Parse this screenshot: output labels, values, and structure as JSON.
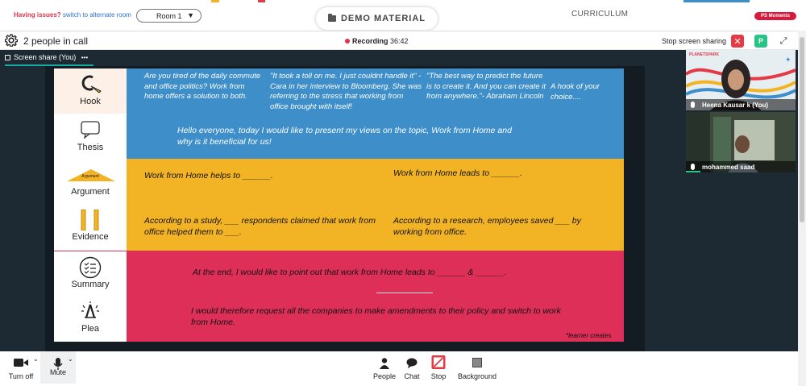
{
  "top": {
    "issues_text": "Having issues?",
    "alt_room_link": "switch to alternate room",
    "room_value": "Room 1",
    "demo_material": "DEMO MATERIAL",
    "curriculum": "CURRICULUM",
    "ps_moments": "PS Moments"
  },
  "call": {
    "people_count": "2 people in call",
    "recording_label": "Recording",
    "recording_time": "36:42",
    "stop_share": "Stop screen sharing",
    "avatar_letter": "P"
  },
  "stage": {
    "share_tab": "Screen share (You)",
    "share_menu": "•••"
  },
  "slide": {
    "labels": {
      "hook": "Hook",
      "thesis": "Thesis",
      "argument": "Argument",
      "argument_banner": "Argument",
      "evidence": "Evidence",
      "summary": "Summary",
      "plea": "Plea"
    },
    "hook_texts": [
      "Are you tired of the daily commute and office politics? Work from home offers a solution to both.",
      "\"It took a toll on me. I just couldnt handle it\" - Cara in her interview to Bloomberg. She was referring to the stress that working from office brought with itself!",
      "\"The best way to predict the future is to create it. And you can create it from anywhere.\"- Abraham Lincoln",
      "A hook of your choice...."
    ],
    "thesis_text": "Hello everyone, today I would like to present my views on the topic, Work from Home and why is it beneficial for us!",
    "argument_1": "Work from Home helps to ______.",
    "argument_2": "Work from Home leads to ______.",
    "evidence_1": "According to a study, ___ respondents claimed that work from office helped them to ___.",
    "evidence_2": "According to a research, employees saved ___ by working from office.",
    "summary_text": "At the end, I would like to point out that work from Home leads to ______ & ______.",
    "plea_text": "I would therefore request all the companies to make amendments to their policy and switch to work from Home.",
    "learner_note": "*learner creates"
  },
  "participants": [
    {
      "name": "Heena Kausar k (You)",
      "logo": "PLANETSPARK"
    },
    {
      "name": "mohammed saad"
    }
  ],
  "toolbar": {
    "camera": "Turn off",
    "mic": "Mute",
    "people": "People",
    "chat": "Chat",
    "stop": "Stop",
    "background": "Background"
  },
  "colors": {
    "blue": "#3d8ec9",
    "yellow": "#f2b324",
    "red": "#dd2f58",
    "teal": "#1aa9a0",
    "green": "#27c487"
  },
  "icons": [
    "gear-icon",
    "folder-icon",
    "close-icon",
    "expand-icon",
    "camera-icon",
    "mic-icon",
    "people-icon",
    "chat-icon",
    "stop-icon",
    "background-icon"
  ]
}
